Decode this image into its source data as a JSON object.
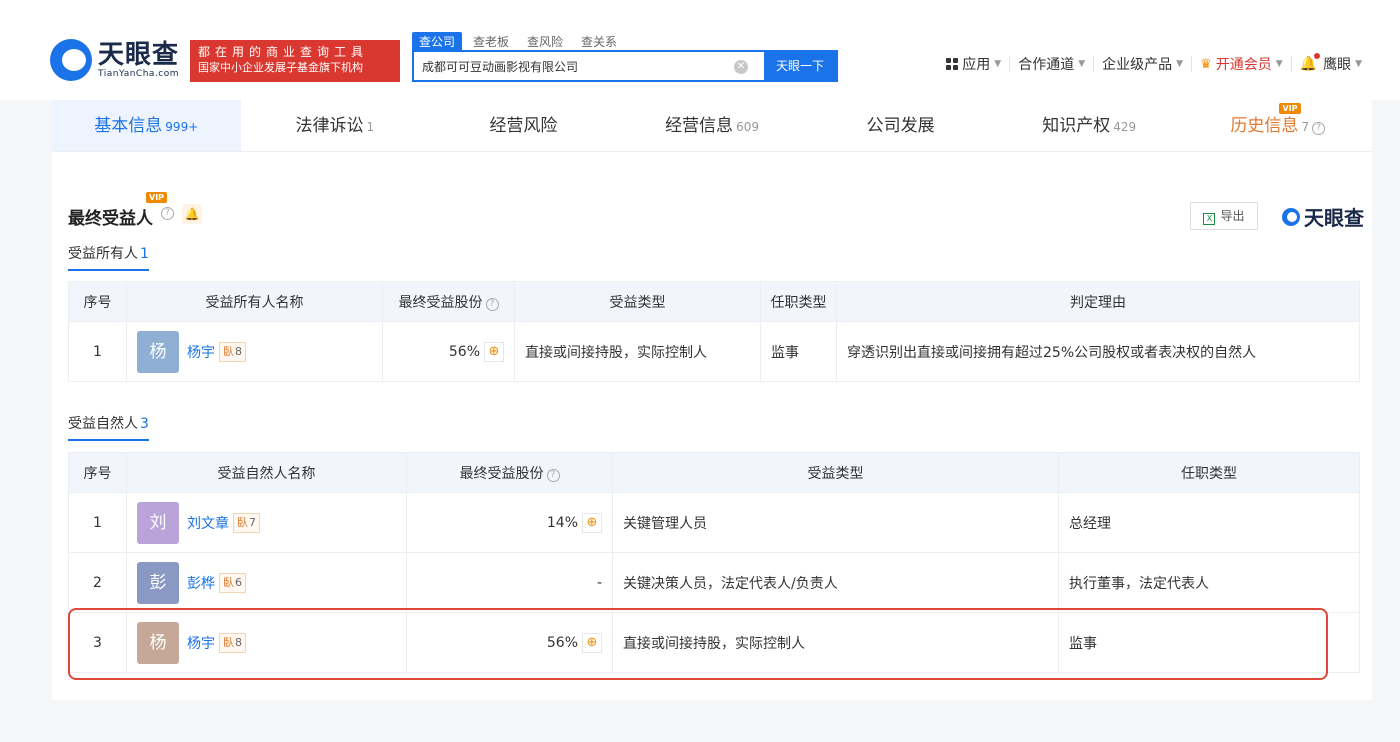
{
  "brand": {
    "name_cn": "天眼查",
    "name_en": "TianYanCha.com",
    "slogan_line1": "都在用的商业查询工具",
    "slogan_line2": "国家中小企业发展子基金旗下机构"
  },
  "search": {
    "tabs": [
      "查公司",
      "查老板",
      "查风险",
      "查关系"
    ],
    "value": "成都可可豆动画影视有限公司",
    "button": "天眼一下"
  },
  "topnav": {
    "apps": "应用",
    "channel": "合作通道",
    "enterprise": "企业级产品",
    "vip": "开通会员",
    "user": "鹰眼"
  },
  "tabs": [
    {
      "label": "基本信息",
      "count": "999+"
    },
    {
      "label": "法律诉讼",
      "count": "1"
    },
    {
      "label": "经营风险",
      "count": ""
    },
    {
      "label": "经营信息",
      "count": "609"
    },
    {
      "label": "公司发展",
      "count": ""
    },
    {
      "label": "知识产权",
      "count": "429"
    },
    {
      "label": "历史信息",
      "count": "7"
    }
  ],
  "vip_badge": "VIP",
  "section": {
    "title": "最终受益人",
    "export": "导出",
    "brand": "天眼查"
  },
  "owners": {
    "heading": "受益所有人",
    "count": "1",
    "columns": [
      "序号",
      "受益所有人名称",
      "最终受益股份",
      "受益类型",
      "任职类型",
      "判定理由"
    ],
    "rows": [
      {
        "no": "1",
        "avatar": "杨",
        "avatar_color": "#8fb0d4",
        "name": "杨宇",
        "tag": "8",
        "share": "56%",
        "type": "直接或间接持股，实际控制人",
        "role": "监事",
        "reason": "穿透识别出直接或间接拥有超过25%公司股权或者表决权的自然人"
      }
    ]
  },
  "natural": {
    "heading": "受益自然人",
    "count": "3",
    "columns": [
      "序号",
      "受益自然人名称",
      "最终受益股份",
      "受益类型",
      "任职类型"
    ],
    "rows": [
      {
        "no": "1",
        "avatar": "刘",
        "avatar_color": "#b9a3d8",
        "name": "刘文章",
        "tag": "7",
        "share": "14%",
        "type": "关键管理人员",
        "role": "总经理"
      },
      {
        "no": "2",
        "avatar": "彭",
        "avatar_color": "#8a99c4",
        "name": "彭桦",
        "tag": "6",
        "share": "-",
        "type": "关键决策人员，法定代表人/负责人",
        "role": "执行董事，法定代表人"
      },
      {
        "no": "3",
        "avatar": "杨",
        "avatar_color": "#c7a898",
        "name": "杨宇",
        "tag": "8",
        "share": "56%",
        "type": "直接或间接持股，实际控制人",
        "role": "监事"
      }
    ]
  },
  "tag_prefix": "臥"
}
